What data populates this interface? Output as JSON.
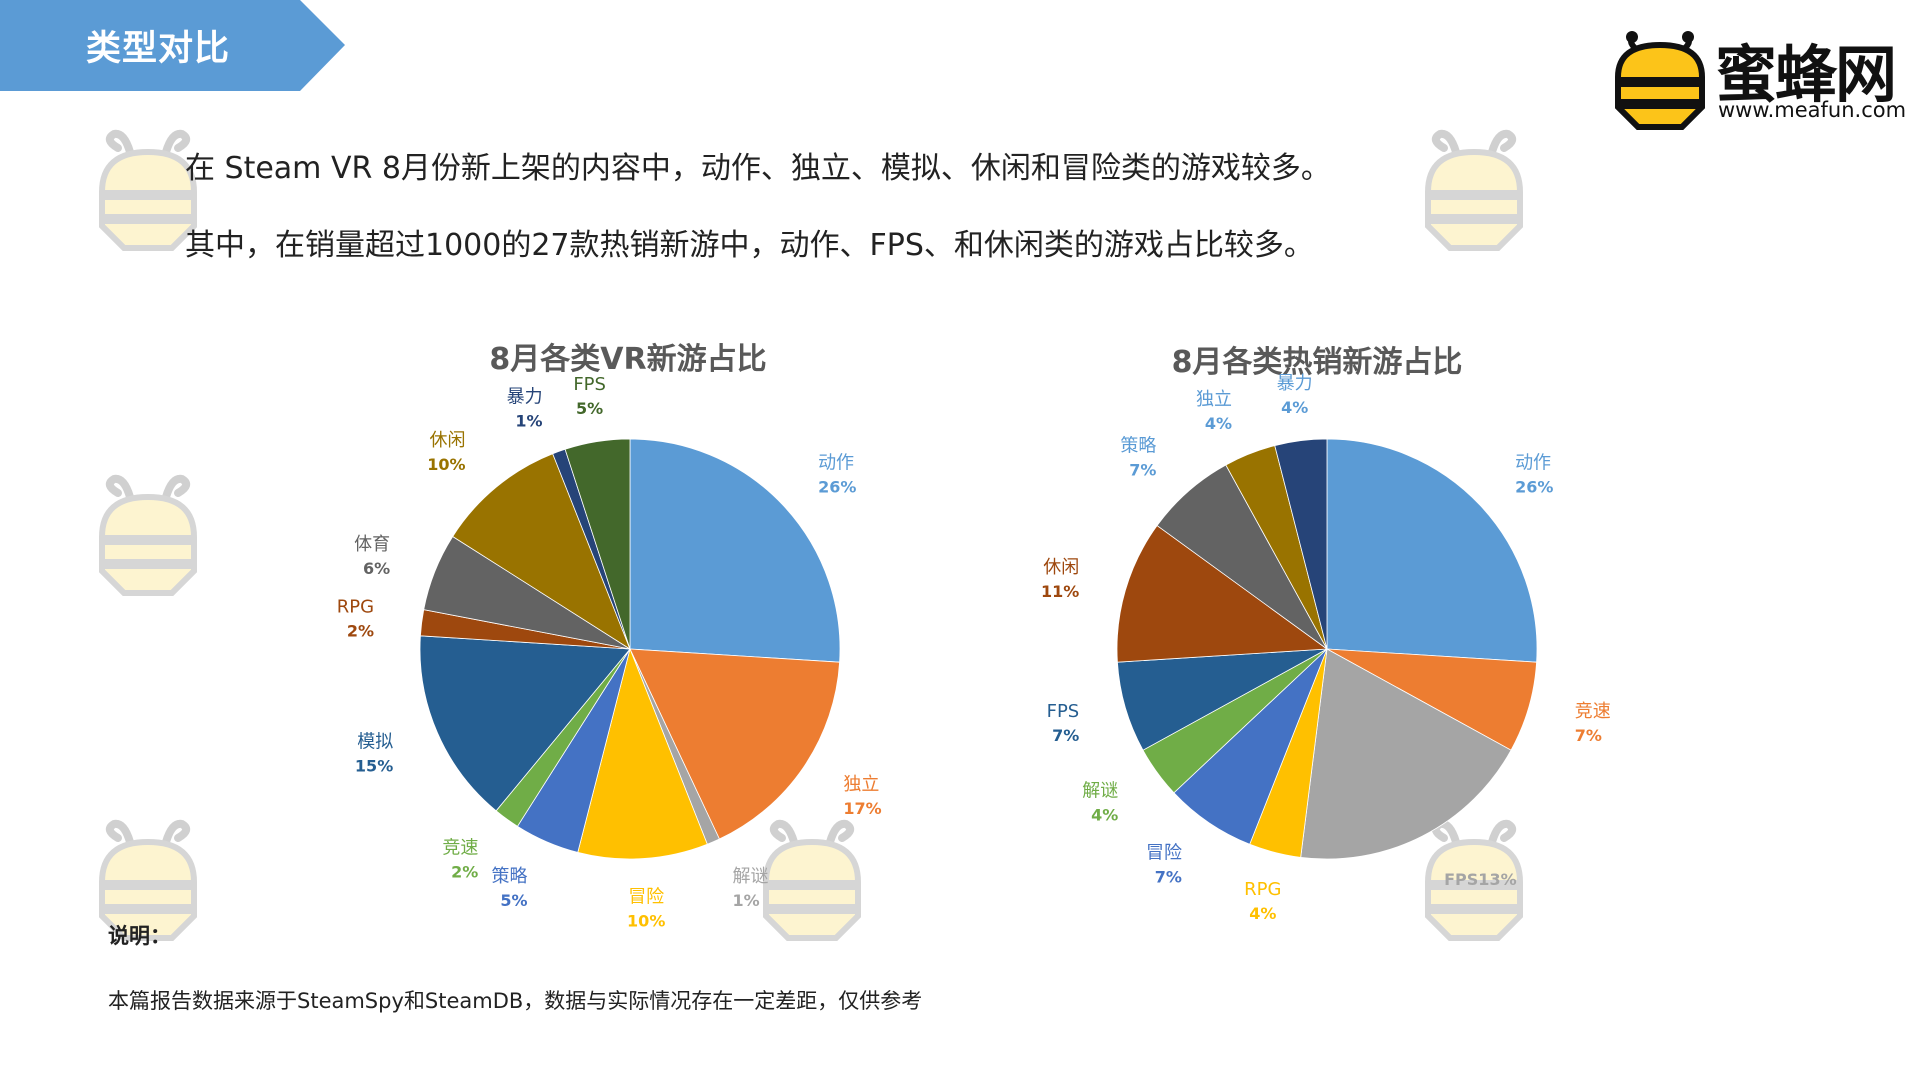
{
  "header": {
    "section_title": "类型对比",
    "banner_color": "#5b9bd5"
  },
  "logo": {
    "name": "蜜蜂网",
    "url": "www.meafun.com"
  },
  "summary": [
    "在 Steam VR 8月份新上架的内容中，动作、独立、模拟、休闲和冒险类的游戏较多。",
    "其中，在销量超过1000的27款热销新游中，动作、FPS、和休闲类的游戏占比较多。"
  ],
  "chart_data": [
    {
      "type": "pie",
      "title": "8月各类VR新游占比",
      "start": "top",
      "direction": "clockwise",
      "slices": [
        {
          "name": "动作",
          "label": "26%",
          "value": 26,
          "color": "#5b9bd5",
          "label_color": "#5b9bd5"
        },
        {
          "name": "独立",
          "label": "17%",
          "value": 17,
          "color": "#ed7d31",
          "label_color": "#ed7d31"
        },
        {
          "name": "解谜",
          "label": "1%",
          "value": 1,
          "color": "#a5a5a5",
          "label_color": "#a5a5a5"
        },
        {
          "name": "冒险",
          "label": "10%",
          "value": 10,
          "color": "#ffc000",
          "label_color": "#ffc000"
        },
        {
          "name": "策略",
          "label": "5%",
          "value": 5,
          "color": "#4472c4",
          "label_color": "#4472c4"
        },
        {
          "name": "竞速",
          "label": "2%",
          "value": 2,
          "color": "#70ad47",
          "label_color": "#70ad47"
        },
        {
          "name": "模拟",
          "label": "15%",
          "value": 15,
          "color": "#255e91",
          "label_color": "#255e91"
        },
        {
          "name": "RPG",
          "label": "2%",
          "value": 2,
          "color": "#9e480e",
          "label_color": "#9e480e"
        },
        {
          "name": "体育",
          "label": "6%",
          "value": 6,
          "color": "#636363",
          "label_color": "#636363"
        },
        {
          "name": "休闲",
          "label": "10%",
          "value": 10,
          "color": "#997300",
          "label_color": "#997300"
        },
        {
          "name": "暴力",
          "label": "1%",
          "value": 1,
          "color": "#264478",
          "label_color": "#264478"
        },
        {
          "name": "FPS",
          "label": "5%",
          "value": 5,
          "color": "#43682b",
          "label_color": "#43682b"
        }
      ]
    },
    {
      "type": "pie",
      "title": "8月各类热销新游占比",
      "start": "top",
      "direction": "clockwise",
      "slices": [
        {
          "name": "动作",
          "label": "26%",
          "value": 26,
          "color": "#5b9bd5",
          "label_color": "#5b9bd5"
        },
        {
          "name": "竞速",
          "label": "7%",
          "value": 7,
          "color": "#ed7d31",
          "label_color": "#ed7d31"
        },
        {
          "name": "",
          "label": "FPS13%",
          "value": 19,
          "color": "#a5a5a5",
          "label_color": "#a5a5a5"
        },
        {
          "name": "RPG",
          "label": "4%",
          "value": 4,
          "color": "#ffc000",
          "label_color": "#ffc000"
        },
        {
          "name": "冒险",
          "label": "7%",
          "value": 7,
          "color": "#4472c4",
          "label_color": "#4472c4"
        },
        {
          "name": "解谜",
          "label": "4%",
          "value": 4,
          "color": "#70ad47",
          "label_color": "#70ad47"
        },
        {
          "name": "FPS",
          "label": "7%",
          "value": 7,
          "color": "#255e91",
          "label_color": "#255e91"
        },
        {
          "name": "休闲",
          "label": "11%",
          "value": 11,
          "color": "#9e480e",
          "label_color": "#9e480e"
        },
        {
          "name": "策略",
          "label": "7%",
          "value": 7,
          "color": "#636363",
          "label_color": "#5b9bd5"
        },
        {
          "name": "独立",
          "label": "4%",
          "value": 4,
          "color": "#997300",
          "label_color": "#5b9bd5"
        },
        {
          "name": "暴力",
          "label": "4%",
          "value": 4,
          "color": "#264478",
          "label_color": "#5b9bd5"
        }
      ]
    }
  ],
  "notes": {
    "label": "说明：",
    "text": "本篇报告数据来源于SteamSpy和SteamDB，数据与实际情况存在一定差距，仅供参考"
  }
}
